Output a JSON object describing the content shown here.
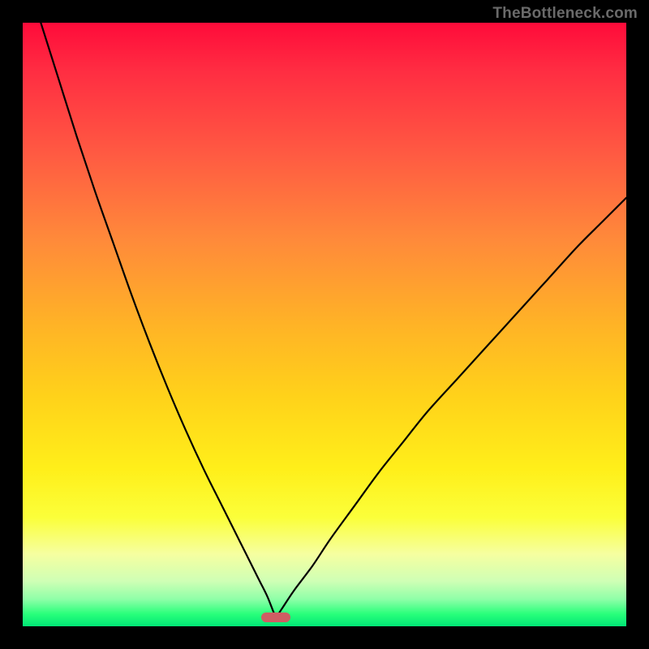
{
  "watermark": {
    "text": "TheBottleneck.com"
  },
  "chart_data": {
    "type": "line",
    "title": "",
    "xlabel": "",
    "ylabel": "",
    "xlim": [
      0,
      100
    ],
    "ylim": [
      0,
      100
    ],
    "grid": false,
    "legend": false,
    "background": "vertical rainbow gradient (red→yellow→green)",
    "marker": {
      "x": 42,
      "y": 1.5,
      "color": "#cf5d63"
    },
    "series": [
      {
        "name": "left-branch",
        "x": [
          3,
          6,
          9,
          12,
          15,
          18,
          21,
          24,
          27,
          30,
          33,
          36,
          39,
          40.5,
          41.5,
          42
        ],
        "y": [
          100,
          90.5,
          81,
          72,
          63.5,
          55,
          47,
          39.5,
          32.5,
          26,
          20,
          14,
          8,
          5,
          2.5,
          1.5
        ]
      },
      {
        "name": "right-branch",
        "x": [
          42,
          43,
          45,
          48,
          51,
          55,
          59,
          63,
          67,
          72,
          77,
          82,
          87,
          92,
          96,
          100
        ],
        "y": [
          1.5,
          3,
          6,
          10,
          14.5,
          20,
          25.5,
          30.5,
          35.5,
          41,
          46.5,
          52,
          57.5,
          63,
          67,
          71
        ]
      }
    ]
  },
  "colors": {
    "frame": "#000000",
    "curve": "#000000",
    "watermark": "#6a6a6a"
  }
}
